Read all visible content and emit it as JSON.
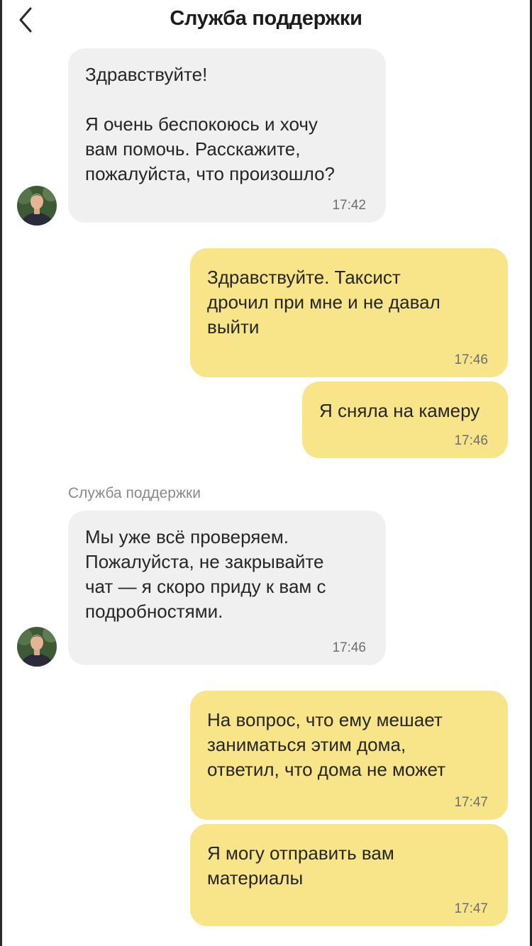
{
  "header": {
    "title": "Служба поддержки",
    "back_icon": "chevron-left-icon"
  },
  "messages": [
    {
      "direction": "incoming",
      "text": "Здравствуйте!\n\nЯ очень беспокоюсь и хочу\nвам помочь. Расскажите,\nпожалуйста, что произошло?",
      "time": "17:42"
    },
    {
      "direction": "outgoing",
      "text": "Здравствуйте. Таксист\nдрочил при мне и не давал\nвыйти",
      "time": "17:46"
    },
    {
      "direction": "outgoing",
      "text": "Я сняла на камеру",
      "time": "17:46"
    },
    {
      "direction": "incoming",
      "sender": "Служба поддержки",
      "text": "Мы уже всё проверяем.\nПожалуйста, не закрывайте\nчат — я скоро приду к вам с\nподробностями.",
      "time": "17:46"
    },
    {
      "direction": "outgoing",
      "text": "На вопрос, что ему мешает\nзаниматься этим дома,\nответил, что дома не может",
      "time": "17:47"
    },
    {
      "direction": "outgoing",
      "text": "Я могу отправить вам\nматериалы",
      "time": "17:47"
    }
  ],
  "colors": {
    "incoming_bubble": "#f0f0f0",
    "outgoing_bubble": "#f8e489"
  }
}
